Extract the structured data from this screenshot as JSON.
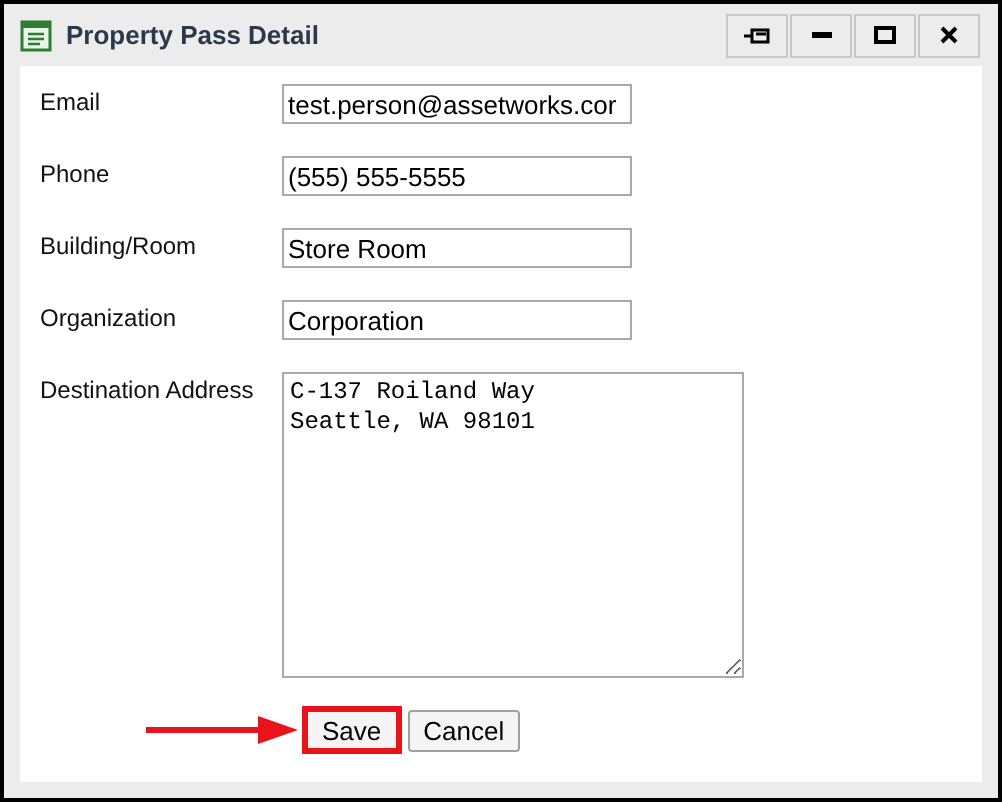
{
  "window": {
    "title": "Property Pass Detail"
  },
  "fields": [
    {
      "label": "Email",
      "value": "test.person@assetworks.cor",
      "kind": "input"
    },
    {
      "label": "Phone",
      "value": "(555) 555-5555",
      "kind": "input"
    },
    {
      "label": "Building/Room",
      "value": "Store Room",
      "kind": "input"
    },
    {
      "label": "Organization",
      "value": "Corporation",
      "kind": "input"
    },
    {
      "label": "Destination Address",
      "value": "C-137 Roiland Way\nSeattle, WA 98101",
      "kind": "textarea"
    }
  ],
  "buttons": [
    {
      "label": "Save",
      "highlighted": true
    },
    {
      "label": "Cancel",
      "highlighted": false
    }
  ]
}
